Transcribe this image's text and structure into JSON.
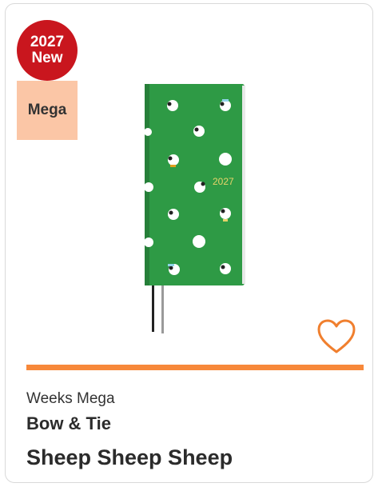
{
  "badges": {
    "year": "2027",
    "new_label": "New",
    "size_label": "Mega"
  },
  "product": {
    "image_icon": "sheep-planner-image",
    "cover_year": "2027",
    "cover_color": "#2e9a45",
    "cover_text_color": "#e7d36a",
    "ribbon_colors": [
      "#222222",
      "#9a9a9a"
    ],
    "format": "Weeks Mega",
    "brand": "Bow & Tie",
    "name": "Sheep Sheep Sheep"
  },
  "actions": {
    "favorite_icon": "heart-outline-icon"
  },
  "colors": {
    "new_badge": "#c9161e",
    "size_badge": "#fbc6a6",
    "accent": "#f7883a"
  }
}
